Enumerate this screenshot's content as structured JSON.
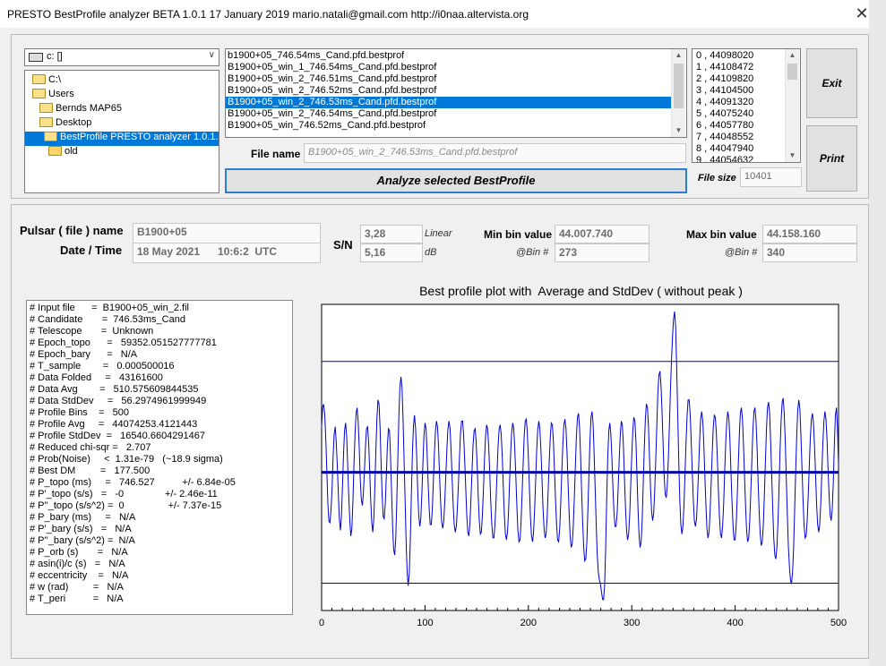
{
  "window": {
    "title": "PRESTO BestProfile analyzer BETA 1.0.1   17 January 2019      mario.natali@gmail.com      http://i0naa.altervista.org",
    "close_glyph": "✕"
  },
  "drive": {
    "value": "c: []"
  },
  "folders": [
    {
      "label": "C:\\",
      "state": "open"
    },
    {
      "label": "Users",
      "state": "open"
    },
    {
      "label": "Bernds MAP65",
      "state": "open"
    },
    {
      "label": "Desktop",
      "state": "open"
    },
    {
      "label": "BestProfile PRESTO analyzer 1.0.1.e",
      "state": "selected"
    },
    {
      "label": "old",
      "state": "closed"
    }
  ],
  "files": [
    "b1900+05_746.54ms_Cand.pfd.bestprof",
    "B1900+05_win_1_746.54ms_Cand.pfd.bestprof",
    "B1900+05_win_2_746.51ms_Cand.pfd.bestprof",
    "B1900+05_win_2_746.52ms_Cand.pfd.bestprof",
    "B1900+05_win_2_746.53ms_Cand.pfd.bestprof",
    "B1900+05_win_2_746.54ms_Cand.pfd.bestprof",
    "B1900+05_win_746.52ms_Cand.pfd.bestprof"
  ],
  "selected_file_index": 4,
  "bins_list": [
    "0  ,  44098020",
    "1  ,  44108472",
    "2  ,  44109820",
    "3  ,  44104500",
    "4  ,  44091320",
    "5  ,  44075240",
    "6  ,  44057780",
    "7  ,  44048552",
    "8  ,  44047940",
    "9  ,  44054632"
  ],
  "buttons": {
    "exit": "Exit",
    "print": "Print",
    "analyze": "Analyze selected BestProfile"
  },
  "file_name": {
    "label": "File name",
    "value": "B1900+05_win_2_746.53ms_Cand.pfd.bestprof"
  },
  "file_size": {
    "label": "File size",
    "value": "10401"
  },
  "pulsar": {
    "name_label": "Pulsar ( file ) name",
    "name_value": "B1900+05",
    "datetime_label": "Date / Time",
    "datetime_value": "18 May 2021      10:6:2  UTC"
  },
  "sn": {
    "label": "S/N",
    "linear_value": "3,28",
    "linear_label": "Linear",
    "db_value": "5,16",
    "db_label": "dB"
  },
  "min_bin": {
    "label": "Min bin value",
    "value": "44.007.740",
    "bin_label": "@Bin #",
    "bin_value": "273"
  },
  "max_bin": {
    "label": "Max bin value",
    "value": "44.158.160",
    "bin_label": "@Bin #",
    "bin_value": "340"
  },
  "info_lines": [
    "# Input file      =  B1900+05_win_2.fil",
    "# Candidate       =  746.53ms_Cand",
    "# Telescope       =  Unknown",
    "# Epoch_topo      =   59352.051527777781",
    "# Epoch_bary      =   N/A",
    "# T_sample        =   0.000500016",
    "# Data Folded     =   43161600",
    "# Data Avg        =   510.575609844535",
    "# Data StdDev     =   56.2974961999949",
    "# Profile Bins    =   500",
    "# Profile Avg     =   44074253.4121443",
    "# Profile StdDev  =   16540.6604291467",
    "# Reduced chi-sqr =   2.707",
    "# Prob(Noise)     <  1.31e-79   (~18.9 sigma)",
    "# Best DM         =   177.500",
    "# P_topo (ms)     =   746.527          +/- 6.84e-05",
    "# P'_topo (s/s)   =   -0               +/- 2.46e-11",
    "# P''_topo (s/s^2) =  0                +/- 7.37e-15",
    "# P_bary (ms)     =   N/A",
    "# P'_bary (s/s)   =   N/A",
    "# P''_bary (s/s^2) =  N/A",
    "# P_orb (s)       =   N/A",
    "# asin(i)/c (s)   =   N/A",
    "# eccentricity    =   N/A",
    "# w (rad)         =   N/A",
    "# T_peri          =   N/A"
  ],
  "chart_data": {
    "type": "line",
    "title": "Best profile plot with  Average and StdDev ( without peak )",
    "xlim": [
      0,
      500
    ],
    "x_ticks": [
      0,
      100,
      200,
      300,
      400,
      500
    ],
    "ylim": [
      44007740,
      44158160
    ],
    "average": 44074253.4,
    "stddev": 16540.7,
    "series": [
      {
        "name": "",
        "y": [
          44098020,
          44108472,
          44109820,
          44104500,
          44091320,
          44075240,
          44057780,
          44048552,
          44047940,
          44054632,
          44066000,
          44082000,
          44094000,
          44098000,
          44090000,
          44078000,
          44063000,
          44050000,
          44044000,
          44051000,
          44067000,
          44084000,
          44096000,
          44100000,
          44093000,
          44078000,
          44062000,
          44049000,
          44041000,
          44045000,
          44060000,
          44078000,
          44094000,
          44105000,
          44108000,
          44101000,
          44087000,
          44071000,
          44060000,
          44057000,
          44063000,
          44075000,
          44088000,
          44097000,
          44098000,
          44090000,
          44076000,
          44060000,
          44048000,
          44043000,
          44050000,
          44066000,
          44086000,
          44103000,
          44112000,
          44110000,
          44097000,
          44079000,
          44062000,
          44051000,
          44050000,
          44058000,
          44073000,
          44088000,
          44097000,
          44096000,
          44083000,
          44064000,
          44046000,
          44034000,
          44031000,
          44040000,
          44059000,
          44082000,
          44104000,
          44119000,
          44124000,
          44118000,
          44102000,
          44080000,
          44058000,
          44037000,
          44021000,
          44015000,
          44022000,
          44040000,
          44063000,
          44085000,
          44099000,
          44104000,
          44097000,
          44083000,
          44066000,
          44052000,
          44046000,
          44050000,
          44063000,
          44079000,
          44093000,
          44100000,
          44097000,
          44085000,
          44069000,
          44055000,
          44047000,
          44047000,
          44055000,
          44069000,
          44084000,
          44096000,
          44101000,
          44098000,
          44087000,
          44072000,
          44058000,
          44048000,
          44045000,
          44049000,
          44059000,
          44073000,
          44087000,
          44097000,
          44101000,
          44097000,
          44086000,
          44071000,
          44057000,
          44047000,
          44043000,
          44046000,
          44055000,
          44068000,
          44082000,
          44094000,
          44101000,
          44101000,
          44094000,
          44081000,
          44066000,
          44052000,
          44043000,
          44041000,
          44047000,
          44060000,
          44075000,
          44088000,
          44096000,
          44097000,
          44090000,
          44077000,
          44062000,
          44049000,
          44042000,
          44043000,
          44052000,
          44066000,
          44081000,
          44093000,
          44099000,
          44097000,
          44088000,
          44074000,
          44059000,
          44047000,
          44040000,
          44040000,
          44047000,
          44059000,
          44074000,
          44088000,
          44097000,
          44099000,
          44094000,
          44082000,
          44067000,
          44052000,
          44042000,
          44039000,
          44043000,
          44054000,
          44069000,
          44084000,
          44095000,
          44100000,
          44097000,
          44087000,
          44072000,
          44056000,
          44044000,
          44038000,
          44039000,
          44048000,
          44063000,
          44079000,
          44093000,
          44101000,
          44102000,
          44095000,
          44082000,
          44066000,
          44051000,
          44041000,
          44038000,
          44043000,
          44055000,
          44071000,
          44086000,
          44097000,
          44101000,
          44097000,
          44086000,
          44071000,
          44056000,
          44045000,
          44040000,
          44042000,
          44051000,
          44065000,
          44080000,
          44093000,
          44100000,
          44099000,
          44090000,
          44076000,
          44060000,
          44047000,
          44039000,
          44038000,
          44045000,
          44058000,
          44074000,
          44089000,
          44099000,
          44102000,
          44097000,
          44085000,
          44069000,
          44053000,
          44041000,
          44035000,
          44037000,
          44046000,
          44061000,
          44078000,
          44093000,
          44103000,
          44105000,
          44098000,
          44083000,
          44065000,
          44048000,
          44035000,
          44028000,
          44029000,
          44038000,
          44054000,
          44073000,
          44091000,
          44103000,
          44106000,
          44099000,
          44084000,
          44065000,
          44046000,
          44031000,
          44022000,
          44018000,
          44016000,
          44012000,
          44008000,
          44007740,
          44015000,
          44035000,
          44060000,
          44082000,
          44096000,
          44100000,
          44094000,
          44081000,
          44066000,
          44053000,
          44046000,
          44046000,
          44053000,
          44066000,
          44081000,
          44094000,
          44101000,
          44099000,
          44088000,
          44072000,
          44056000,
          44044000,
          44039000,
          44042000,
          44052000,
          44067000,
          44083000,
          44096000,
          44103000,
          44101000,
          44090000,
          44073000,
          44055000,
          44041000,
          44035000,
          44038000,
          44050000,
          44068000,
          44087000,
          44102000,
          44110000,
          44108000,
          44098000,
          44082000,
          44066000,
          44054000,
          44049000,
          44053000,
          44064000,
          44081000,
          44099000,
          44115000,
          44125000,
          44127000,
          44120000,
          44106000,
          44089000,
          44073000,
          44063000,
          44061000,
          44067000,
          44081000,
          44098000,
          44116000,
          44132000,
          44145000,
          44154000,
          44158160,
          44150000,
          44130000,
          44105000,
          44080000,
          44060000,
          44047000,
          44042000,
          44046000,
          44057000,
          44073000,
          44090000,
          44104000,
          44112000,
          44112000,
          44104000,
          44090000,
          44074000,
          44059000,
          44049000,
          44046000,
          44050000,
          44061000,
          44076000,
          44091000,
          44102000,
          44106000,
          44101000,
          44089000,
          44073000,
          44057000,
          44045000,
          44040000,
          44043000,
          44053000,
          44068000,
          44084000,
          44097000,
          44104000,
          44103000,
          44095000,
          44081000,
          44065000,
          44051000,
          44042000,
          44040000,
          44046000,
          44058000,
          44074000,
          44090000,
          44101000,
          44106000,
          44102000,
          44091000,
          44075000,
          44059000,
          44046000,
          44039000,
          44039000,
          44047000,
          44061000,
          44078000,
          44094000,
          44105000,
          44108000,
          44102000,
          44089000,
          44072000,
          44056000,
          44044000,
          44038000,
          44040000,
          44049000,
          44064000,
          44081000,
          44096000,
          44106000,
          44108000,
          44101000,
          44087000,
          44070000,
          44054000,
          44042000,
          44036000,
          44038000,
          44047000,
          44062000,
          44080000,
          44097000,
          44108000,
          44111000,
          44105000,
          44091000,
          44073000,
          44055000,
          44040000,
          44031000,
          44029000,
          44035000,
          44048000,
          44066000,
          44085000,
          44101000,
          44111000,
          44113000,
          44105000,
          44090000,
          44071000,
          44052000,
          44036000,
          44025000,
          44018000,
          44016000,
          44022000,
          44035000,
          44054000,
          44075000,
          44094000,
          44107000,
          44112000,
          44107000,
          44094000,
          44077000,
          44060000,
          44047000,
          44040000,
          44041000,
          44049000,
          44062000,
          44078000,
          44092000,
          44102000,
          44105000,
          44100000,
          44088000,
          44073000,
          44058000,
          44047000,
          44043000,
          44047000,
          44058000,
          44073000,
          44089000,
          44101000,
          44106000,
          44102000,
          44091000,
          44076000,
          44062000,
          44052000,
          44049000,
          44055000,
          44069000,
          44088000,
          44104000,
          44108000,
          44098000,
          44078000
        ]
      }
    ]
  }
}
